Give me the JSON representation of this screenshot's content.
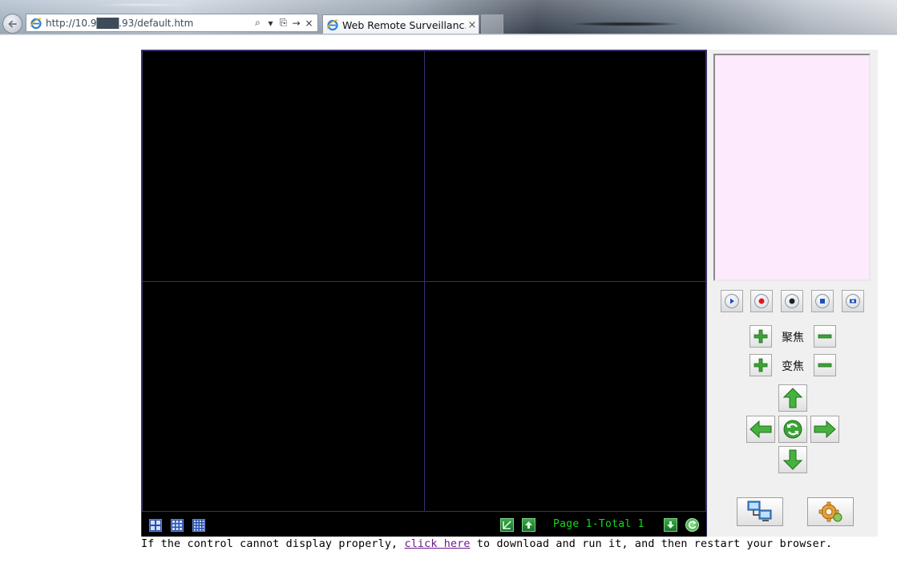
{
  "browser": {
    "url": "http://10.9███.93/default.htm",
    "tab_title": "Web Remote Surveillanc...",
    "tab_close": "×",
    "addr_search": "⌕",
    "addr_dropdown": "▾",
    "addr_compat": "⎘",
    "addr_go": "→",
    "addr_stop": "×",
    "icons": {
      "back": "back-arrow-icon",
      "site": "ie-icon"
    }
  },
  "player": {
    "page_status": "Page 1-Total 1",
    "status_color": "#19d51f",
    "grid_line_color": "#3a2f6e"
  },
  "ptz": {
    "focus_label": "聚焦",
    "zoom_label": "变焦",
    "accent_green": "#2f9e2a"
  },
  "panel": {
    "preview_color": "#fdeafc"
  },
  "footer": {
    "before_link": "If the control cannot display properly, ",
    "link_text": "click here",
    "after_link": " to download and run it, and then restart your browser."
  }
}
